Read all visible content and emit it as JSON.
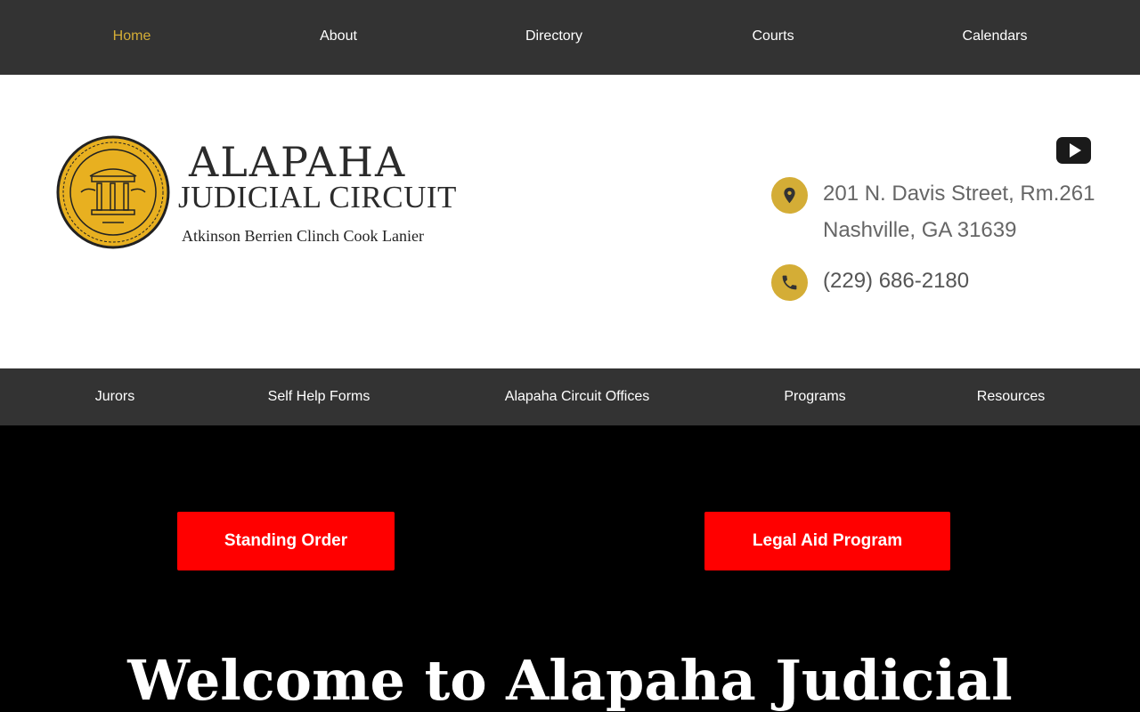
{
  "top_nav": {
    "items": [
      {
        "label": "Home",
        "active": true
      },
      {
        "label": "About"
      },
      {
        "label": "Directory"
      },
      {
        "label": "Courts"
      },
      {
        "label": "Calendars"
      }
    ]
  },
  "header": {
    "seal_icon": "state-of-georgia-seal-icon",
    "title": "ALAPAHA",
    "subtitle": "JUDICIAL CIRCUIT",
    "counties": "Atkinson Berrien Clinch Cook Lanier",
    "social_icon": "youtube-icon",
    "address_line1": "201 N. Davis Street, Rm.261",
    "address_line2": "Nashville, GA 31639",
    "phone": "(229) 686-2180",
    "accent_color": "#d4ad36"
  },
  "sub_nav": {
    "items": [
      {
        "label": "Jurors"
      },
      {
        "label": "Self Help Forms"
      },
      {
        "label": "Alapaha Circuit Offices"
      },
      {
        "label": "Programs"
      },
      {
        "label": "Resources"
      }
    ]
  },
  "hero": {
    "buttons": [
      {
        "label": "Standing Order"
      },
      {
        "label": "Legal Aid Program"
      }
    ],
    "button_color": "#ff0000",
    "welcome": "Welcome to Alapaha Judicial"
  }
}
